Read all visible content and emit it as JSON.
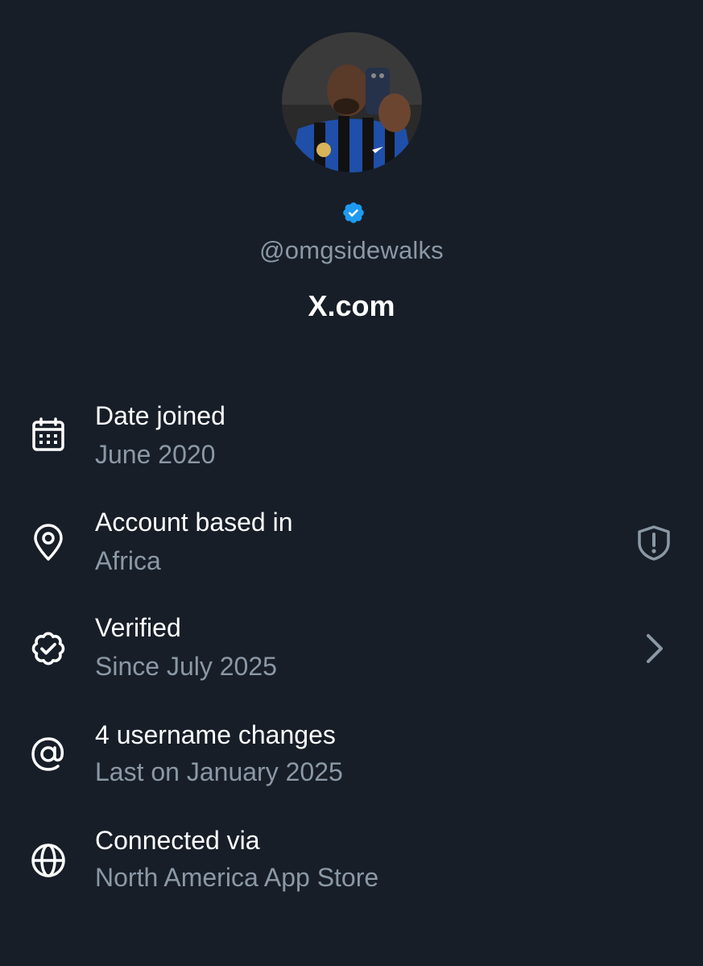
{
  "profile": {
    "handle": "@omgsidewalks",
    "site": "X.com",
    "avatar_icon": "profile-photo",
    "verified_color": "#1d9bf0"
  },
  "rows": [
    {
      "icon": "calendar-icon",
      "title": "Date joined",
      "subtitle": "June 2020"
    },
    {
      "icon": "location-pin-icon",
      "title": "Account based in",
      "subtitle": "Africa",
      "action_icon": "shield-alert-icon"
    },
    {
      "icon": "verified-seal-icon",
      "title": "Verified",
      "subtitle": "Since July 2025",
      "action_icon": "chevron-right-icon"
    },
    {
      "icon": "at-sign-icon",
      "title": "4 username changes",
      "subtitle": "Last on January 2025"
    },
    {
      "icon": "globe-icon",
      "title": "Connected via",
      "subtitle": "North America App Store"
    }
  ],
  "colors": {
    "background": "#171e28",
    "primary_text": "#ffffff",
    "secondary_text": "#8b98a5",
    "accent": "#1d9bf0"
  }
}
